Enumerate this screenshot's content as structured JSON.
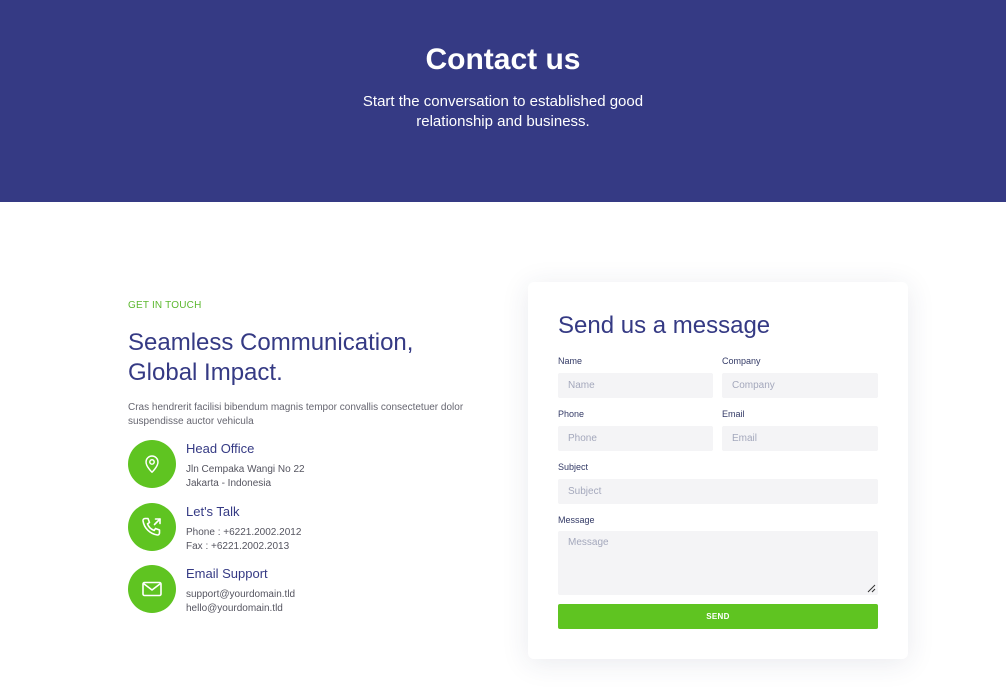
{
  "hero": {
    "title": "Contact us",
    "subtitle": "Start the conversation to established good relationship and business."
  },
  "intro": {
    "eyebrow": "GET IN TOUCH",
    "headline_line1": "Seamless Communication,",
    "headline_line2": "Global Impact.",
    "description": "Cras hendrerit facilisi bibendum magnis tempor convallis consectetuer dolor suspendisse auctor vehicula"
  },
  "contacts": [
    {
      "icon": "location-pin-icon",
      "title": "Head Office",
      "line1": "Jln Cempaka Wangi No 22",
      "line2": "Jakarta - Indonesia"
    },
    {
      "icon": "phone-outgoing-icon",
      "title": "Let's Talk",
      "line1": "Phone : +6221.2002.2012",
      "line2": "Fax : +6221.2002.2013"
    },
    {
      "icon": "envelope-icon",
      "title": "Email Support",
      "line1": "support@yourdomain.tld",
      "line2": "hello@yourdomain.tld"
    }
  ],
  "form": {
    "title": "Send us a message",
    "name_label": "Name",
    "name_placeholder": "Name",
    "company_label": "Company",
    "company_placeholder": "Company",
    "phone_label": "Phone",
    "phone_placeholder": "Phone",
    "email_label": "Email",
    "email_placeholder": "Email",
    "subject_label": "Subject",
    "subject_placeholder": "Subject",
    "message_label": "Message",
    "message_placeholder": "Message",
    "submit_label": "SEND"
  },
  "colors": {
    "primary": "#353a84",
    "accent": "#5fc421",
    "field_bg": "#f4f4f6"
  }
}
